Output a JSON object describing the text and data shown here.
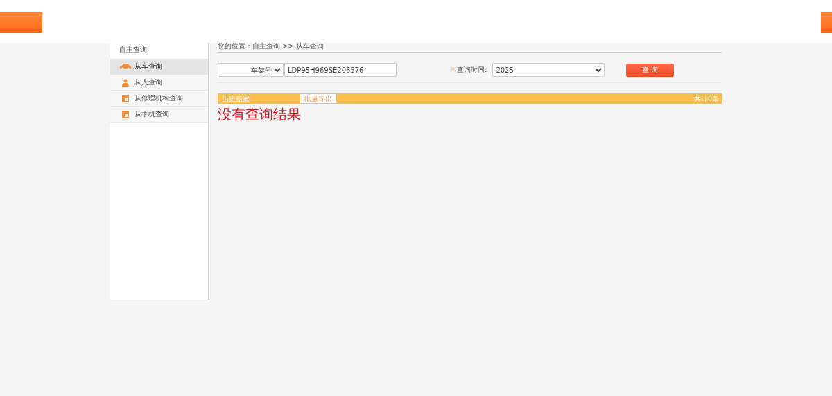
{
  "sidebar": {
    "title": "自主查询",
    "items": [
      {
        "label": "从车查询",
        "selected": true,
        "kind": "car"
      },
      {
        "label": "从人查询",
        "selected": false,
        "kind": "person"
      },
      {
        "label": "从修理机构查询",
        "selected": false,
        "kind": "calendar"
      },
      {
        "label": "从手机查询",
        "selected": false,
        "kind": "calendar"
      }
    ]
  },
  "breadcrumb": "您的位置：自主查询 >> 从车查询",
  "search": {
    "type_select": "车架号",
    "value": "LDP95H969SE206576",
    "required_mark": "*",
    "time_label": "查询时间:",
    "time_select": "2025",
    "button": "查 询"
  },
  "results": {
    "title": "历史赔案",
    "export_button": "批量导出",
    "total": "共计0条",
    "empty_message": "没有查询结果"
  }
}
